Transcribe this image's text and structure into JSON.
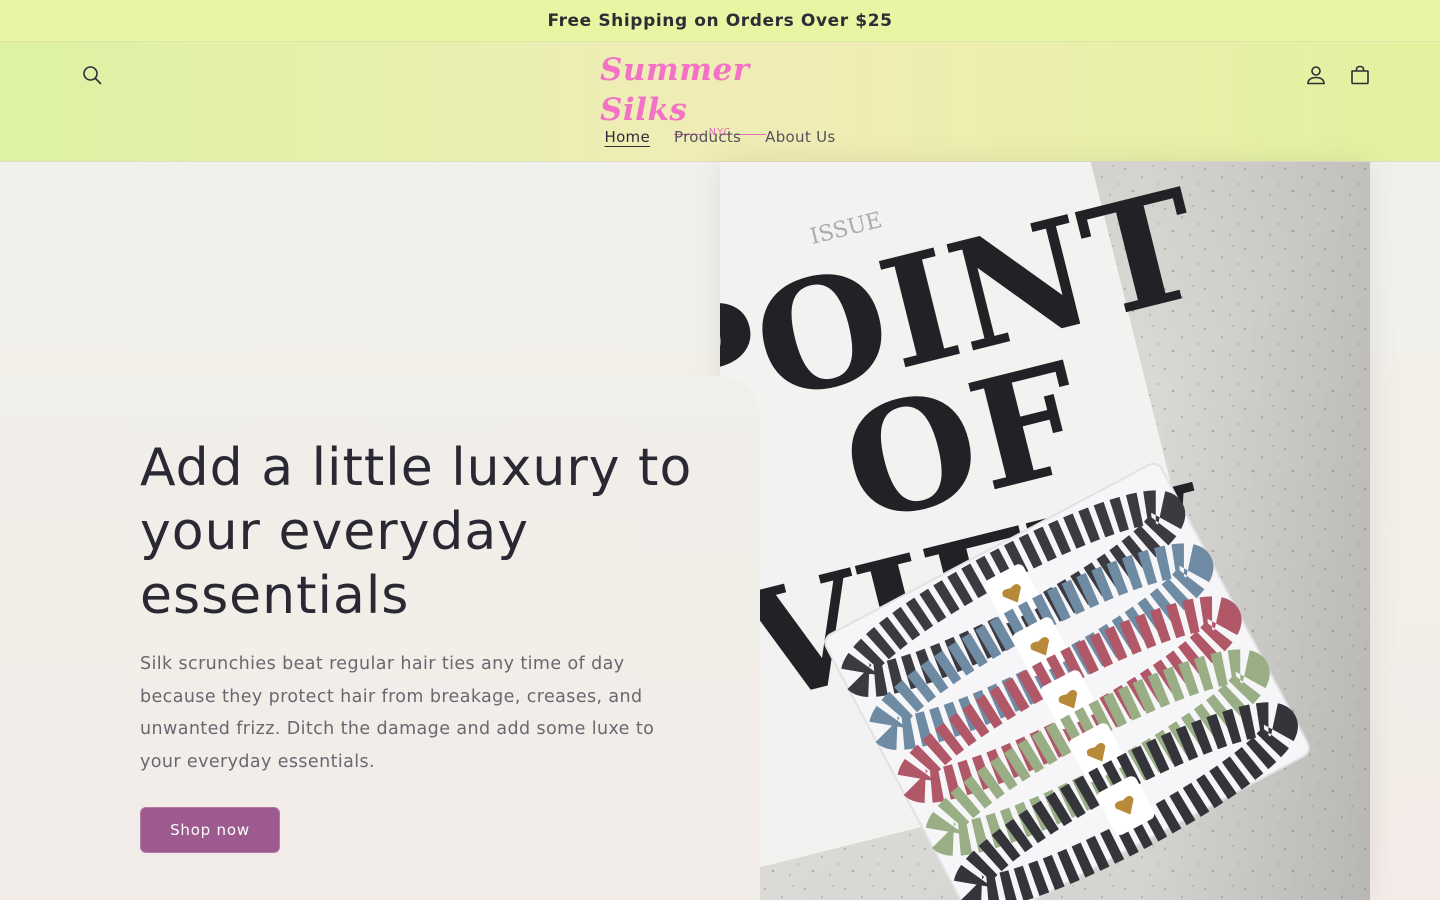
{
  "announcement": {
    "text": "Free Shipping on Orders Over $25"
  },
  "header": {
    "logo": {
      "main": "Summer Silks",
      "sub": "NYC"
    },
    "icons": {
      "search": "search-icon",
      "account": "account-icon",
      "cart": "cart-icon"
    },
    "nav": [
      {
        "label": "Home",
        "active": true
      },
      {
        "label": "Products",
        "active": false
      },
      {
        "label": "About Us",
        "active": false
      }
    ]
  },
  "hero": {
    "title": "Add a little luxury to your everyday essentials",
    "text": "Silk scrunchies beat regular hair ties any time of day because they protect hair from breakage, creases, and unwanted frizz. Ditch the damage and add some luxe to your everyday essentials.",
    "button_label": "Shop now",
    "image": {
      "alt": "Silk scrunchies on a magazine page",
      "magazine_text": [
        "POINT",
        "OF",
        "VIEW"
      ]
    }
  },
  "colors": {
    "announcement_bg": "#e8f5a2",
    "logo_pink": "#f472c6",
    "button_bg": "#9c5a8e",
    "text_dark": "#2a2832",
    "text_body": "#6a6771"
  }
}
